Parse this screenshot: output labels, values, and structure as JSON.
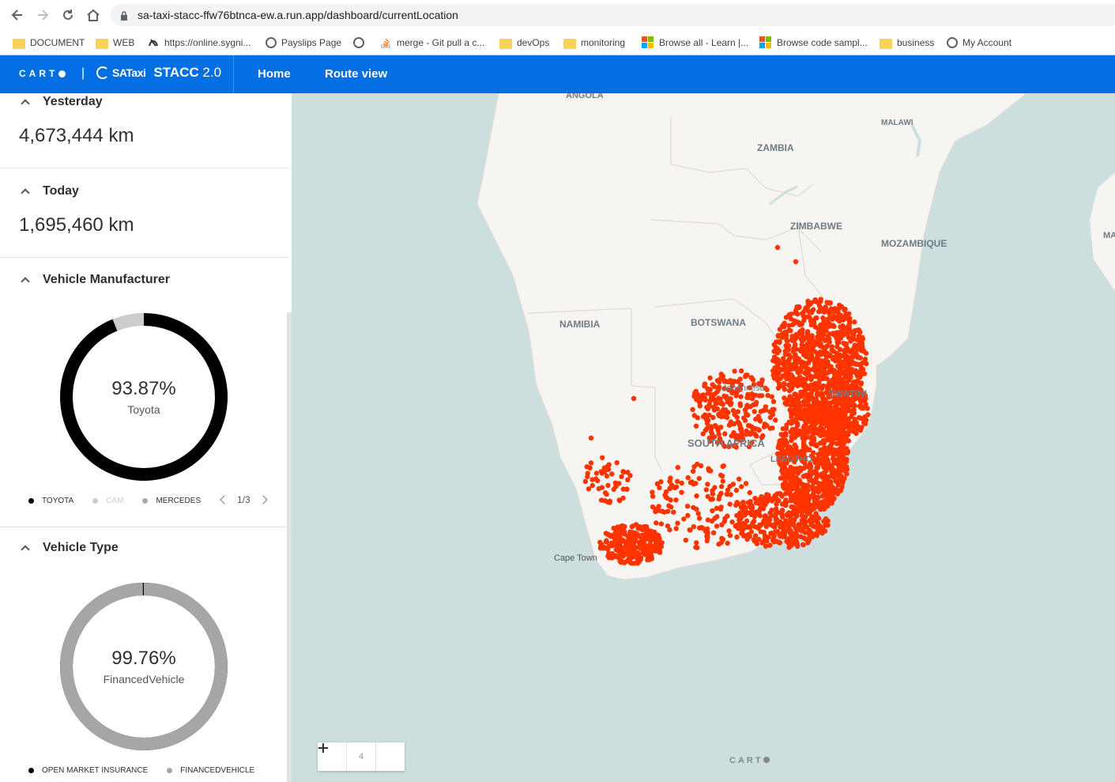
{
  "browser": {
    "url": "sa-taxi-stacc-ffw76btnca-ew.a.run.app/dashboard/currentLocation",
    "bookmarks": [
      {
        "label": "DOCUMENT",
        "icon": "folder-icon"
      },
      {
        "label": "WEB",
        "icon": "folder-icon"
      },
      {
        "label": "https://online.sygni...",
        "icon": "sygnia-icon"
      },
      {
        "label": "Payslips Page",
        "icon": "globe-icon"
      },
      {
        "label": "",
        "icon": "globe-icon"
      },
      {
        "label": "merge - Git pull a c...",
        "icon": "stackoverflow-icon"
      },
      {
        "label": "devOps",
        "icon": "folder-icon"
      },
      {
        "label": "monitoring",
        "icon": "folder-icon"
      },
      {
        "label": "Browse all - Learn |...",
        "icon": "microsoft-icon"
      },
      {
        "label": "Browse code sampl...",
        "icon": "microsoft-icon"
      },
      {
        "label": "business",
        "icon": "folder-icon"
      },
      {
        "label": "My Account",
        "icon": "globe-icon"
      }
    ]
  },
  "header": {
    "logo_text": "CART",
    "separator": "|",
    "brand_name": "SATaxi",
    "product_name": "STACC",
    "product_version": "2.0",
    "nav": [
      "Home",
      "Route view"
    ],
    "accent_color": "#036fe2"
  },
  "sidebar": {
    "yesterday": {
      "title": "Yesterday",
      "value": "4,673,444 km"
    },
    "today": {
      "title": "Today",
      "value": "1,695,460 km"
    },
    "manufacturer": {
      "title": "Vehicle Manufacturer",
      "center_value": "93.87%",
      "center_label": "Toyota",
      "share": 0.9387,
      "legend": [
        {
          "label": "TOYOTA",
          "color": "#000000"
        },
        {
          "label": "CAM",
          "color": "#cccccc"
        },
        {
          "label": "MERCEDES",
          "color": "#aaaaaa"
        }
      ],
      "pager": "1/3"
    },
    "vehicle_type": {
      "title": "Vehicle Type",
      "center_value": "99.76%",
      "center_label": "FinancedVehicle",
      "share": 0.9976,
      "legend": [
        {
          "label": "OPEN MARKET INSURANCE",
          "color": "#000000"
        },
        {
          "label": "FINANCEDVEHICLE",
          "color": "#a6a6a6"
        }
      ]
    }
  },
  "map": {
    "labels": {
      "angola": "ANGOLA",
      "zambia": "ZAMBIA",
      "malawi": "MALAWI",
      "zimbabwe": "ZIMBABWE",
      "mozambique": "MOZAMBIQUE",
      "namibia": "NAMIBIA",
      "botswana": "BOTSWANA",
      "eswatini": "SWATINI",
      "south_africa": "SOUTH AFRICA",
      "lesotho": "LESOTHO",
      "johannesburg": "Johannesb",
      "cape_town": "Cape Town",
      "madagascar_edge": "MA"
    },
    "zoom_level": "4",
    "attribution": "CART",
    "point_color": "#ff3300",
    "water_color": "#cddedf",
    "land_color": "#f7f5f2"
  }
}
